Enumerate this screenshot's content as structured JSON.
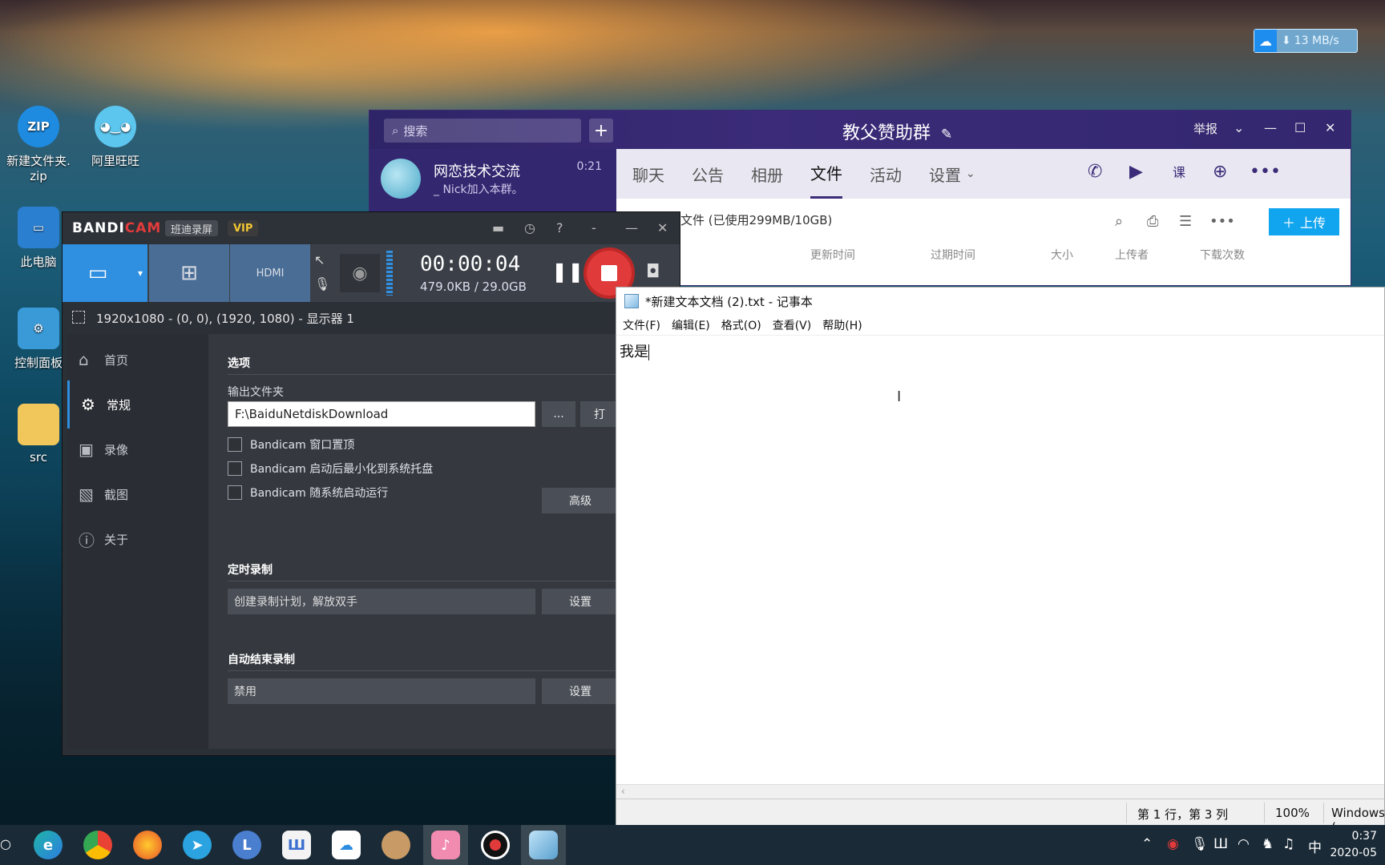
{
  "desktop": {
    "icons": [
      {
        "label": "新建文件夹.\nzip",
        "icon": "zip-archive-icon"
      },
      {
        "label": "阿里旺旺",
        "icon": "aliwangwang-icon"
      },
      {
        "label": "此电脑",
        "icon": "this-pc-icon"
      },
      {
        "label": "控制面板",
        "icon": "control-panel-icon"
      },
      {
        "label": "src",
        "icon": "folder-icon"
      }
    ]
  },
  "baidu_overlay": {
    "speed": "13 MB/s",
    "arrow": "⬇"
  },
  "qq": {
    "search_placeholder": "搜索",
    "group_title": "教父赞助群",
    "report": "举报",
    "conversation": {
      "name": "网恋技术交流",
      "last_message": "_ Nick加入本群。",
      "time": "0:21"
    },
    "tabs": [
      "聊天",
      "公告",
      "相册",
      "文件",
      "活动",
      "设置"
    ],
    "active_tab": "文件",
    "files_summary": "文件 (已使用299MB/10GB)",
    "upload_label": "上传",
    "columns": [
      "更新时间",
      "过期时间",
      "大小",
      "上传者",
      "下载次数"
    ]
  },
  "bandicam": {
    "logo_a": "BANDI",
    "logo_b": "CAM",
    "badge_cn": "班迪录屏",
    "badge_vip": "VIP",
    "timer": "00:00:04",
    "size": "479.0KB / 29.0GB",
    "region": "1920x1080 - (0, 0), (1920, 1080) - 显示器 1",
    "sidebar": [
      {
        "label": "首页",
        "icon": "home-icon"
      },
      {
        "label": "常规",
        "icon": "gear-icon"
      },
      {
        "label": "录像",
        "icon": "video-icon"
      },
      {
        "label": "截图",
        "icon": "image-icon"
      },
      {
        "label": "关于",
        "icon": "info-icon"
      }
    ],
    "sidebar_active": "常规",
    "options_title": "选项",
    "output_folder_label": "输出文件夹",
    "output_folder": "F:\\BaiduNetdiskDownload",
    "browse_label": "...",
    "open_label": "打",
    "checkboxes": [
      "Bandicam 窗口置顶",
      "Bandicam 启动后最小化到系统托盘",
      "Bandicam 随系统启动运行"
    ],
    "advanced_label": "高级",
    "timer_title": "定时录制",
    "timer_desc": "创建录制计划，解放双手",
    "auto_end_title": "自动结束录制",
    "auto_end_value": "禁用",
    "settings_label": "设置"
  },
  "notepad": {
    "title": "*新建文本文档 (2).txt - 记事本",
    "menu": [
      "文件(F)",
      "编辑(E)",
      "格式(O)",
      "查看(V)",
      "帮助(H)"
    ],
    "content": "我是",
    "status_pos": "第 1 行，第 3 列",
    "status_zoom": "100%",
    "status_eol": "Windows ("
  },
  "taskbar": {
    "apps": [
      "edge",
      "chrome",
      "firefox",
      "telegram",
      "L",
      "word-like",
      "baidu-netdisk",
      "avatar",
      "pink-app",
      "bandicam-rec",
      "notepad"
    ],
    "tray_ime": "中",
    "time": "0:37",
    "date": "2020-05"
  }
}
